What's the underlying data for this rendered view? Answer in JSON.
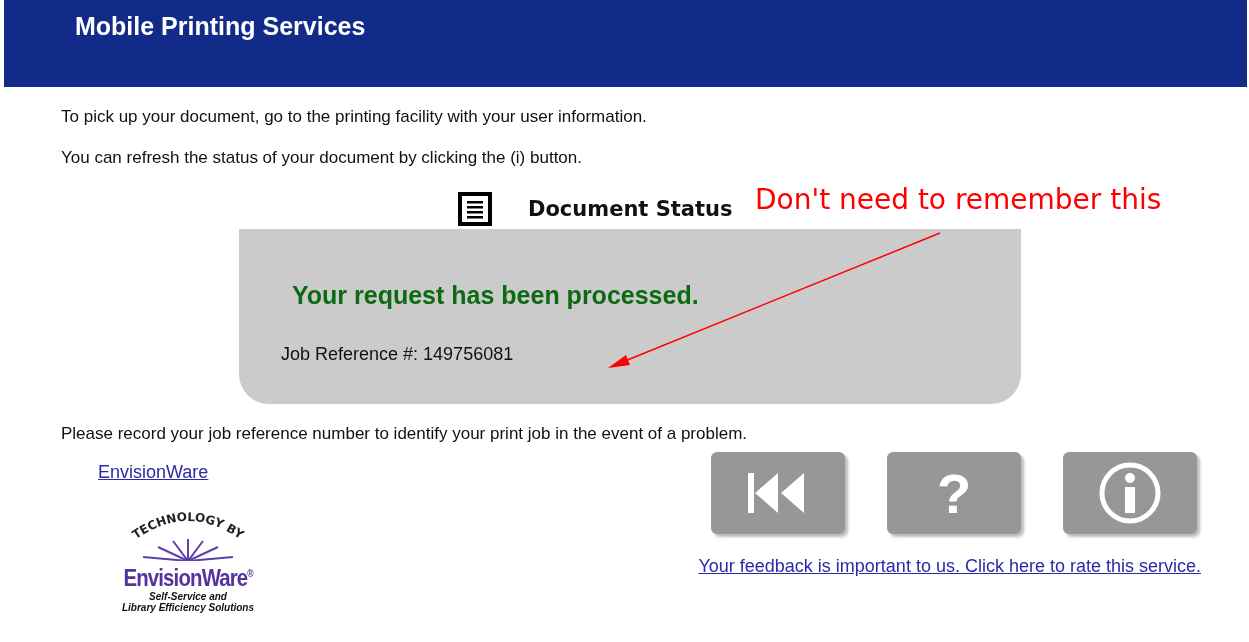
{
  "header": {
    "title": "Mobile Printing Services"
  },
  "instructions": [
    "To pick up your document, go to the printing facility with your user information.",
    "You can refresh the status of your document by clicking the (i) button."
  ],
  "status_panel": {
    "heading": "Document Status",
    "message": "Your request has been processed.",
    "job_reference": "Job Reference #: 149756081"
  },
  "note": "Please record your job reference number to identify your print job in the event of a problem.",
  "envisionware_link": "EnvisionWare",
  "logo": {
    "arc_text": "TECHNOLOGY BY",
    "brand": "EnvisionWare",
    "registered": "®",
    "tagline": [
      "Self-Service and",
      "Library Efficiency Solutions"
    ]
  },
  "buttons": [
    {
      "kind": "back"
    },
    {
      "kind": "help",
      "glyph": "?"
    },
    {
      "kind": "info"
    }
  ],
  "feedback_link": "Your feedback is important to us. Click here to rate this service.",
  "annotation": {
    "text": "Don't need to remember this"
  }
}
